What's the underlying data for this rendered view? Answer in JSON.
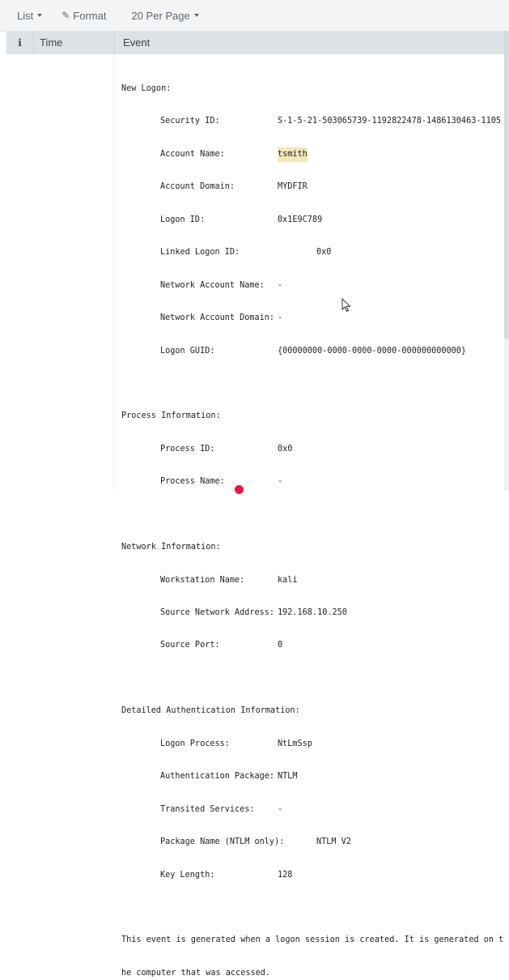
{
  "toolbar": {
    "list_label": "List",
    "format_label": "Format",
    "per_page_label": "20 Per Page"
  },
  "table": {
    "columns": [
      "i",
      "Time",
      "Event"
    ]
  },
  "event": {
    "new_logon": {
      "heading": "New Logon:",
      "security_id_label": "Security ID:",
      "security_id": "S-1-5-21-503065739-1192822478-1486130463-1105",
      "account_name_label": "Account Name:",
      "account_name": "tsmith",
      "account_domain_label": "Account Domain:",
      "account_domain": "MYDFIR",
      "logon_id_label": "Logon ID:",
      "logon_id": "0x1E9C789",
      "linked_logon_id_label": "Linked Logon ID:",
      "linked_logon_id": "0x0",
      "network_account_name_label": "Network Account Name:",
      "network_account_name": "-",
      "network_account_domain_label": "Network Account Domain:",
      "network_account_domain": "-",
      "logon_guid_label": "Logon GUID:",
      "logon_guid": "{00000000-0000-0000-0000-000000000000}"
    },
    "process": {
      "heading": "Process Information:",
      "process_id_label": "Process ID:",
      "process_id": "0x0",
      "process_name_label": "Process Name:",
      "process_name": "-"
    },
    "network": {
      "heading": "Network Information:",
      "workstation_name_label": "Workstation Name:",
      "workstation_name": "kali",
      "source_address_label": "Source Network Address:",
      "source_address": "192.168.10.250",
      "source_port_label": "Source Port:",
      "source_port": "0"
    },
    "auth": {
      "heading": "Detailed Authentication Information:",
      "logon_process_label": "Logon Process:",
      "logon_process": "NtLmSsp",
      "auth_package_label": "Authentication Package:",
      "auth_package": "NTLM",
      "transited_label": "Transited Services:",
      "transited": "-",
      "package_name_label": "Package Name (NTLM only):",
      "package_name": "NTLM V2",
      "key_length_label": "Key Length:",
      "key_length": "128"
    },
    "description_line1": "This event is generated when a logon session is created. It is generated on t",
    "description_line2": "he computer that was accessed."
  }
}
